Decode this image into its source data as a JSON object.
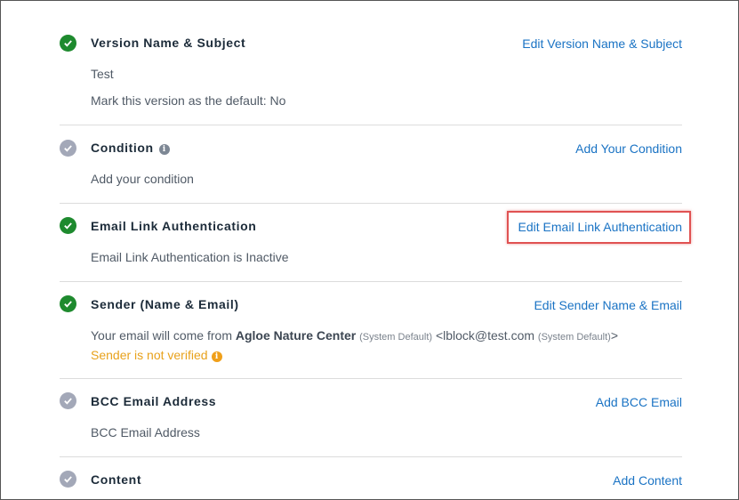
{
  "sections": [
    {
      "title": "Version Name & Subject",
      "status": "done",
      "link": "Edit Version Name & Subject",
      "lines": [
        "Test",
        "Mark this version as the default: No"
      ]
    },
    {
      "title": "Condition",
      "status": "todo",
      "link": "Add Your Condition",
      "lines": [
        "Add your condition"
      ]
    },
    {
      "title": "Email Link Authentication",
      "status": "done",
      "link": "Edit Email Link Authentication",
      "lines": [
        "Email Link Authentication is Inactive"
      ]
    },
    {
      "title": "Sender (Name & Email)",
      "status": "done",
      "link": "Edit Sender Name & Email",
      "sender": {
        "prefix": "Your email will come from ",
        "name": "Agloe Nature Center",
        "name_note": "(System Default)",
        "email": "<lblock@test.com",
        "email_note": "(System Default)",
        "suffix": ">",
        "warning": "Sender is not verified"
      }
    },
    {
      "title": "BCC Email Address",
      "status": "todo",
      "link": "Add BCC Email",
      "lines": [
        "BCC Email Address"
      ]
    },
    {
      "title": "Content",
      "status": "todo",
      "link": "Add Content",
      "lines": []
    }
  ],
  "colors": {
    "done": "#1e8a2e",
    "todo": "#a3a8b8",
    "link": "#1a73c4",
    "warning": "#e8a21c",
    "highlight": "#e05252"
  },
  "icons": {
    "done": "check-icon",
    "todo": "check-icon",
    "info": "info-icon"
  }
}
